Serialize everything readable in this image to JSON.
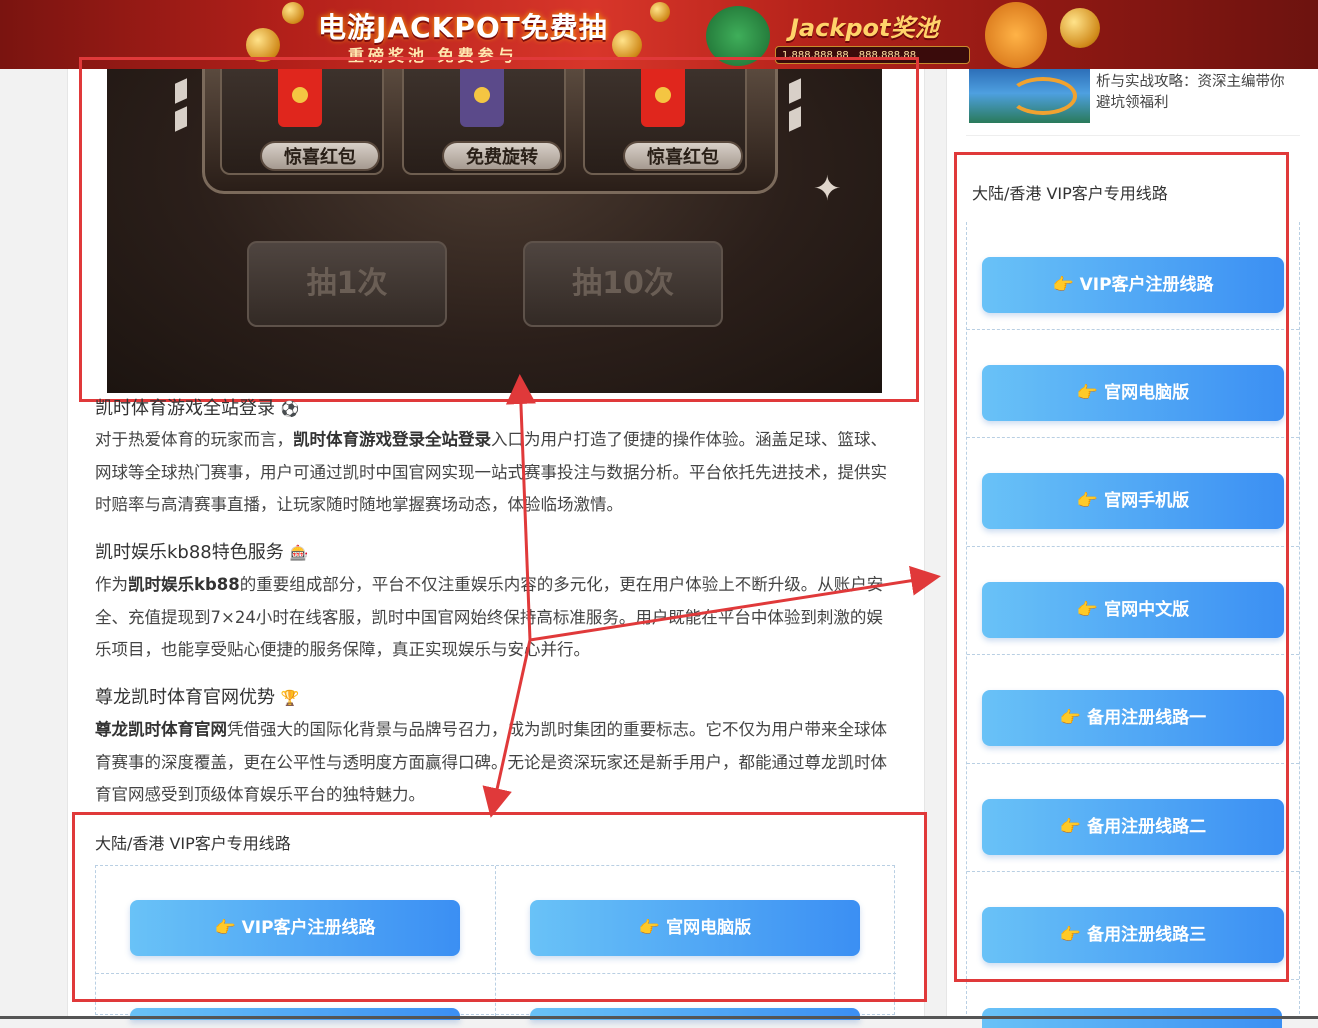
{
  "banner": {
    "title": "电游JACKPOT免费抽",
    "subtitle": "重磅奖池 免费参与",
    "jackpot_label": "Jackpot奖池",
    "jackpot_value_1": "1,888,888.88",
    "jackpot_value_2": "888,888.88"
  },
  "slot": {
    "reel_labels": [
      "惊喜红包",
      "免费旋转",
      "惊喜红包"
    ],
    "spin_once": "抽1次",
    "spin_ten": "抽10次"
  },
  "sections": [
    {
      "heading": "凯时体育游戏全站登录",
      "heading_icon": "⚽",
      "bold": "凯时体育游戏登录全站登录",
      "lead": "对于热爱体育的玩家而言，",
      "text": "入口为用户打造了便捷的操作体验。涵盖足球、篮球、网球等全球热门赛事，用户可通过凯时中国官网实现一站式赛事投注与数据分析。平台依托先进技术，提供实时赔率与高清赛事直播，让玩家随时随地掌握赛场动态，体验临场激情。"
    },
    {
      "heading": "凯时娱乐kb88特色服务",
      "heading_icon": "🎰",
      "lead": "作为",
      "bold": "凯时娱乐kb88",
      "text": "的重要组成部分，平台不仅注重娱乐内容的多元化，更在用户体验上不断升级。从账户安全、充值提现到7×24小时在线客服，凯时中国官网始终保持高标准服务。用户既能在平台中体验到刺激的娱乐项目，也能享受贴心便捷的服务保障，真正实现娱乐与安心并行。"
    },
    {
      "heading": "尊龙凯时体育官网优势",
      "heading_icon": "🏆",
      "lead": "",
      "bold": "尊龙凯时体育官网",
      "text": "凭借强大的国际化背景与品牌号召力，成为凯时集团的重要标志。它不仅为用户带来全球体育赛事的深度覆盖，更在公平性与透明度方面赢得口碑。无论是资深玩家还是新手用户，都能通过尊龙凯时体育官网感受到顶级体育娱乐平台的独特魅力。"
    }
  ],
  "main_links": {
    "title": "大陆/香港 VIP客户专用线路",
    "buttons": [
      "VIP客户注册线路",
      "官网电脑版"
    ]
  },
  "sidebar": {
    "news_text": "析与实战攻略：资深主编带你避坑领福利",
    "links_title": "大陆/香港 VIP客户专用线路",
    "buttons": [
      "VIP客户注册线路",
      "官网电脑版",
      "官网手机版",
      "官网中文版",
      "备用注册线路一",
      "备用注册线路二",
      "备用注册线路三"
    ]
  },
  "icons": {
    "hand": "👉"
  },
  "colors": {
    "annotation": "#e0393a",
    "button_start": "#69c2f7",
    "button_end": "#3b8ff3"
  }
}
